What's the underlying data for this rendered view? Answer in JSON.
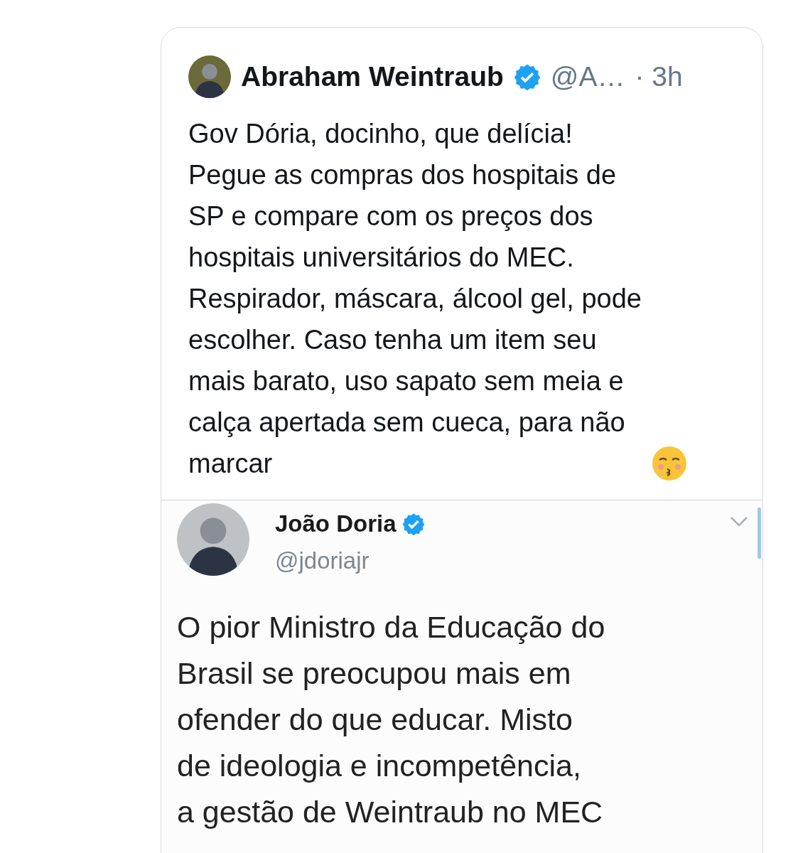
{
  "quoted_tweet": {
    "author": {
      "name": "Abraham Weintraub",
      "verified": true,
      "handle": "@A…",
      "time": "· 3h"
    },
    "text": "Gov Dória, docinho, que delícia!\nPegue as compras dos hospitais de\nSP e compare com os preços dos\nhospitais universitários do MEC.\nRespirador, máscara, álcool gel, pode\nescolher. Caso tenha um item seu\nmais barato, uso sapato sem meia e\ncalça apertada sem cueca, para não\nmarcar",
    "embedded_screenshot": {
      "author": {
        "name": "João Doria",
        "verified": true,
        "handle": "@jdoriajr"
      },
      "text": "O pior Ministro da Educação do\nBrasil se preocupou mais em\nofender do que educar. Misto\nde ideologia e incompetência,\na gestão de Weintraub no MEC"
    }
  }
}
